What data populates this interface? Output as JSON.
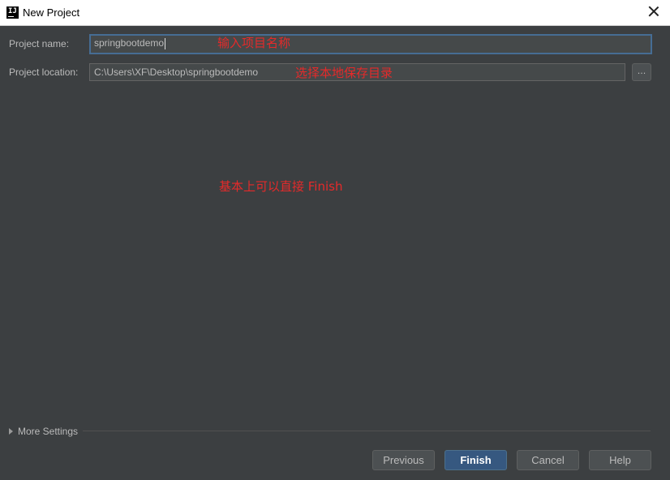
{
  "window": {
    "title": "New Project",
    "app_icon": "intellij-icon",
    "close_icon": "close-icon"
  },
  "form": {
    "name_label": "Project name:",
    "name_value": "springbootdemo",
    "location_label": "Project location:",
    "location_value": "C:\\Users\\XF\\Desktop\\springbootdemo",
    "browse_label": "..."
  },
  "annotations": {
    "name_note": "输入项目名称",
    "location_note": "选择本地保存目录",
    "finish_note": "基本上可以直接 Finish"
  },
  "more_settings": {
    "label": "More Settings",
    "expanded": false
  },
  "buttons": {
    "previous": "Previous",
    "finish": "Finish",
    "cancel": "Cancel",
    "help": "Help"
  },
  "colors": {
    "background": "#3c3f41",
    "focus_border": "#466d94",
    "primary_button": "#365880",
    "annotation": "#e52a2a"
  }
}
